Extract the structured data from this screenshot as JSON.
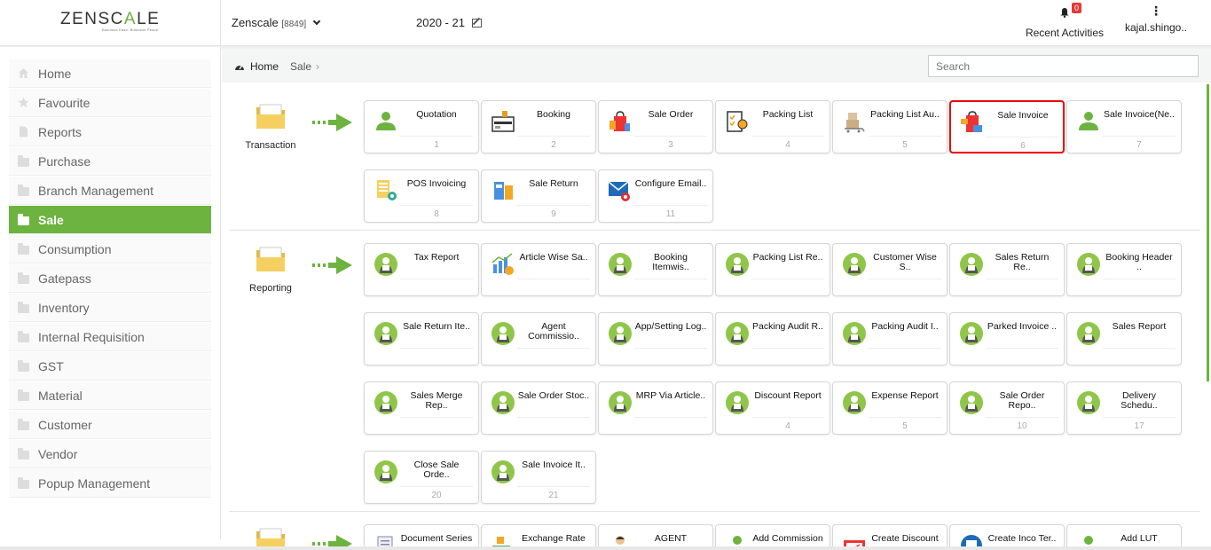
{
  "header": {
    "logo_pre": "ZENSC",
    "logo_accent": "A",
    "logo_post": "LE",
    "tagline": "Business Ease. Business Peace.",
    "company": "Zenscale",
    "company_code": "[8849]",
    "year": "2020 - 21",
    "recent_badge": "0",
    "recent_label": "Recent Activities",
    "user": "kajal.shingo.."
  },
  "sidebar": {
    "items": [
      {
        "label": "Home",
        "icon": "home-icon"
      },
      {
        "label": "Favourite",
        "icon": "star-icon"
      },
      {
        "label": "Reports",
        "icon": "document-icon"
      },
      {
        "label": "Purchase",
        "icon": "folder-icon"
      },
      {
        "label": "Branch Management",
        "icon": "folder-icon"
      },
      {
        "label": "Sale",
        "icon": "folder-icon"
      },
      {
        "label": "Consumption",
        "icon": "folder-icon"
      },
      {
        "label": "Gatepass",
        "icon": "folder-icon"
      },
      {
        "label": "Inventory",
        "icon": "folder-icon"
      },
      {
        "label": "Internal Requisition",
        "icon": "folder-icon"
      },
      {
        "label": "GST",
        "icon": "folder-icon"
      },
      {
        "label": "Material",
        "icon": "folder-icon"
      },
      {
        "label": "Customer",
        "icon": "folder-icon"
      },
      {
        "label": "Vendor",
        "icon": "folder-icon"
      },
      {
        "label": "Popup Management",
        "icon": "folder-icon"
      }
    ],
    "active": "Sale"
  },
  "breadcrumb": {
    "home": "Home",
    "current": "Sale",
    "sep": "›"
  },
  "search": {
    "placeholder": "Search"
  },
  "sections": {
    "transaction": {
      "label": "Transaction",
      "tiles": [
        {
          "label": "Quotation",
          "num": "1"
        },
        {
          "label": "Booking",
          "num": "2"
        },
        {
          "label": "Sale Order",
          "num": "3"
        },
        {
          "label": "Packing List",
          "num": "4"
        },
        {
          "label": "Packing List Au..",
          "num": "5"
        },
        {
          "label": "Sale Invoice",
          "num": "6"
        },
        {
          "label": "Sale Invoice(Ne..",
          "num": "7"
        },
        {
          "label": "POS Invoicing",
          "num": "8"
        },
        {
          "label": "Sale Return",
          "num": "9"
        },
        {
          "label": "Configure Email..",
          "num": "11"
        }
      ]
    },
    "reporting": {
      "label": "Reporting",
      "tiles": [
        {
          "label": "Tax Report",
          "num": ""
        },
        {
          "label": "Article Wise Sa..",
          "num": ""
        },
        {
          "label": "Booking Itemwis..",
          "num": ""
        },
        {
          "label": "Packing List Re..",
          "num": ""
        },
        {
          "label": "Customer Wise S..",
          "num": ""
        },
        {
          "label": "Sales Return Re..",
          "num": ""
        },
        {
          "label": "Booking Header ..",
          "num": ""
        },
        {
          "label": "Sale Return Ite..",
          "num": ""
        },
        {
          "label": "Agent Commissio..",
          "num": ""
        },
        {
          "label": "App/Setting Log..",
          "num": ""
        },
        {
          "label": "Packing Audit R..",
          "num": ""
        },
        {
          "label": "Packing Audit I..",
          "num": ""
        },
        {
          "label": "Parked Invoice ..",
          "num": ""
        },
        {
          "label": "Sales Report",
          "num": ""
        },
        {
          "label": "Sales Merge Rep..",
          "num": ""
        },
        {
          "label": "Sale Order Stoc..",
          "num": ""
        },
        {
          "label": "MRP Via Article..",
          "num": ""
        },
        {
          "label": "Discount Report",
          "num": "4"
        },
        {
          "label": "Expense Report",
          "num": "5"
        },
        {
          "label": "Sale Order Repo..",
          "num": "10"
        },
        {
          "label": "Delivery Schedu..",
          "num": "17"
        },
        {
          "label": "Close Sale Orde..",
          "num": "20"
        },
        {
          "label": "Sale Invoice It..",
          "num": "21"
        }
      ]
    },
    "master": {
      "tiles": [
        {
          "label": "Document Series",
          "num": ""
        },
        {
          "label": "Exchange Rate",
          "num": ""
        },
        {
          "label": "AGENT",
          "num": ""
        },
        {
          "label": "Add Commission",
          "num": ""
        },
        {
          "label": "Create Discount",
          "num": ""
        },
        {
          "label": "Create Inco Ter..",
          "num": ""
        },
        {
          "label": "Add LUT",
          "num": ""
        }
      ]
    }
  },
  "colors": {
    "accent": "#6cb33f",
    "highlight": "#e00000",
    "folder": "#f2c94c"
  }
}
